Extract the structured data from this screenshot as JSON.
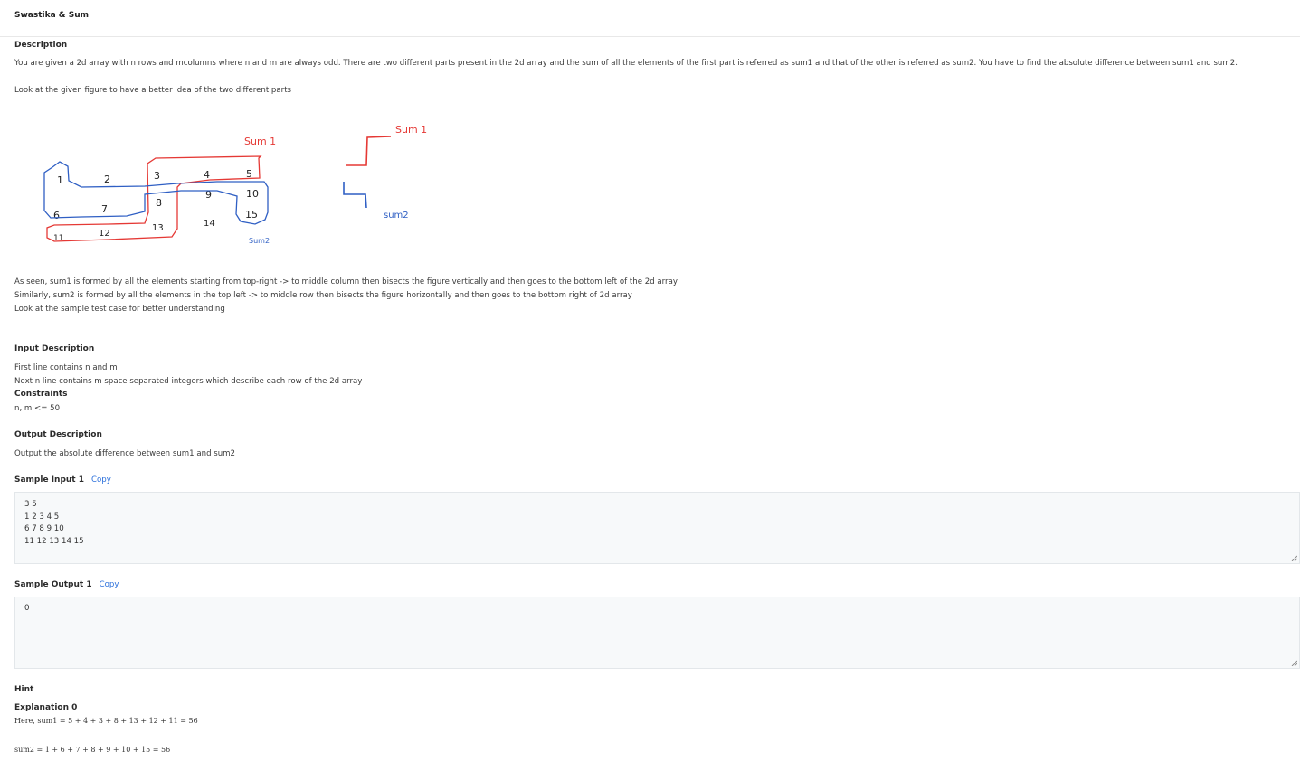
{
  "problem": {
    "title": "Swastika & Sum",
    "description_heading": "Description",
    "description_line1": "You are given a 2d array with n  rows and mcolumns where n and m are always odd. There are two different parts present in the 2d array and the sum of all the elements of the first part is referred as sum1 and that of the other is referred as sum2. You have to find the absolute difference between sum1 and sum2.",
    "description_line2": "Look at the given figure to have a better idea of the two different parts",
    "figure": {
      "grid_numbers": [
        "1",
        "2",
        "3",
        "4",
        "5",
        "6",
        "7",
        "8",
        "9",
        "10",
        "11",
        "12",
        "13",
        "14",
        "15"
      ],
      "label_sum1_a": "Sum 1",
      "label_sum2_a": "Sum2",
      "label_sum1_b": "Sum 1",
      "label_sum2_b": "sum2",
      "sum1_color": "#e53935",
      "sum2_color": "#2f5fc4"
    },
    "explain_line1": "As seen, sum1 is formed by all the elements starting from top-right -> to middle column then bisects the figure vertically and then goes to the bottom left of the 2d array",
    "explain_line2": "Similarly, sum2 is formed by all the elements in the top left -> to middle row then bisects the figure horizontally and then goes to the bottom right of 2d array",
    "explain_line3": "Look at the sample test case for better understanding",
    "input_heading": "Input Description",
    "input_line1": "First line contains n and m",
    "input_line2": "Next n line contains m space separated integers which describe each row of the 2d array",
    "constraints_heading": "Constraints",
    "constraints_line": "n, m <= 50",
    "output_heading": "Output Description",
    "output_line": "Output the absolute difference between sum1 and sum2",
    "sample_input_heading": "Sample Input 1",
    "sample_input_copy": "Copy",
    "sample_input_lines": [
      "3 5",
      "1 2 3 4 5",
      "6 7 8 9 10",
      "11 12 13 14 15"
    ],
    "sample_output_heading": "Sample Output 1",
    "sample_output_copy": "Copy",
    "sample_output_lines": [
      "0"
    ],
    "hint_heading": "Hint",
    "explanation_heading": "Explanation 0",
    "explanation_line1": "Here, sum1 = 5 + 4 + 3 + 8 + 13 + 12 + 11 = 56",
    "explanation_line2": "sum2 = 1 + 6 + 7 + 8 + 9 + 10 + 15 = 56"
  }
}
